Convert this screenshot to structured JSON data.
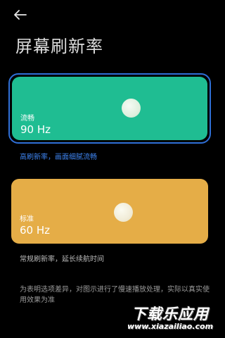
{
  "header": {
    "back_icon": "arrow-left-icon",
    "title": "屏幕刷新率"
  },
  "options": [
    {
      "label": "流畅",
      "value": "90 Hz",
      "description": "高刷新率，画面细腻流畅",
      "selected": true,
      "color": "#1fbd92"
    },
    {
      "label": "标准",
      "value": "60 Hz",
      "description": "常规刷新率，延长续航时间",
      "selected": false,
      "color": "#e5ad47"
    }
  ],
  "note": "为表明选项差异，对图示进行了慢速播放处理，实际以真实使用效果为准",
  "watermark": {
    "main": "下载乐应用",
    "url": "www.xiazailiao.com"
  },
  "colors": {
    "background": "#000000",
    "selection_border": "#2f6fd6",
    "accent_text": "#3e84f0"
  }
}
